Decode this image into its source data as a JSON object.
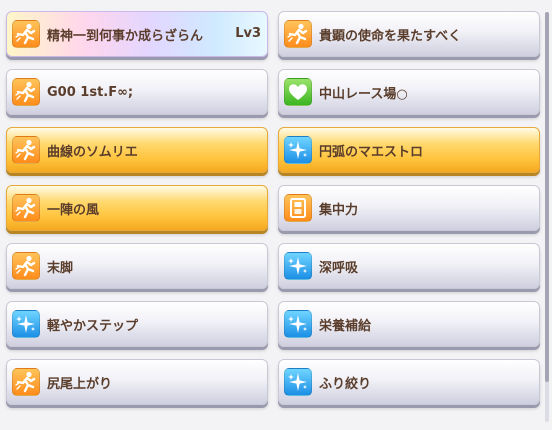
{
  "skills": [
    {
      "name": "精神一到何事か成らざらん",
      "level": "Lv3",
      "style": "rainbow",
      "icon": "runner-icon",
      "icon_color": "orange"
    },
    {
      "name": "貴顕の使命を果たすべく",
      "level": "",
      "style": "normal",
      "icon": "runner-icon",
      "icon_color": "orange"
    },
    {
      "name": "G00 1st.F∞;",
      "level": "",
      "style": "normal",
      "icon": "runner-icon",
      "icon_color": "orange"
    },
    {
      "name": "中山レース場○",
      "level": "",
      "style": "normal",
      "icon": "heart-icon",
      "icon_color": "green"
    },
    {
      "name": "曲線のソムリエ",
      "level": "",
      "style": "gold",
      "icon": "runner-icon",
      "icon_color": "orange"
    },
    {
      "name": "円弧のマエストロ",
      "level": "",
      "style": "gold",
      "icon": "sparkle-icon",
      "icon_color": "blue"
    },
    {
      "name": "一陣の風",
      "level": "",
      "style": "gold",
      "icon": "runner-icon",
      "icon_color": "orange"
    },
    {
      "name": "集中力",
      "level": "",
      "style": "normal",
      "icon": "gate-icon",
      "icon_color": "orange"
    },
    {
      "name": "末脚",
      "level": "",
      "style": "normal",
      "icon": "runner-icon",
      "icon_color": "orange"
    },
    {
      "name": "深呼吸",
      "level": "",
      "style": "normal",
      "icon": "sparkle-icon",
      "icon_color": "blue"
    },
    {
      "name": "軽やかステップ",
      "level": "",
      "style": "normal",
      "icon": "sparkle-icon",
      "icon_color": "blue"
    },
    {
      "name": "栄養補給",
      "level": "",
      "style": "normal",
      "icon": "sparkle-icon",
      "icon_color": "blue"
    },
    {
      "name": "尻尾上がり",
      "level": "",
      "style": "normal",
      "icon": "runner-icon",
      "icon_color": "orange"
    },
    {
      "name": "ふり絞り",
      "level": "",
      "style": "normal",
      "icon": "sparkle-icon",
      "icon_color": "blue"
    }
  ]
}
